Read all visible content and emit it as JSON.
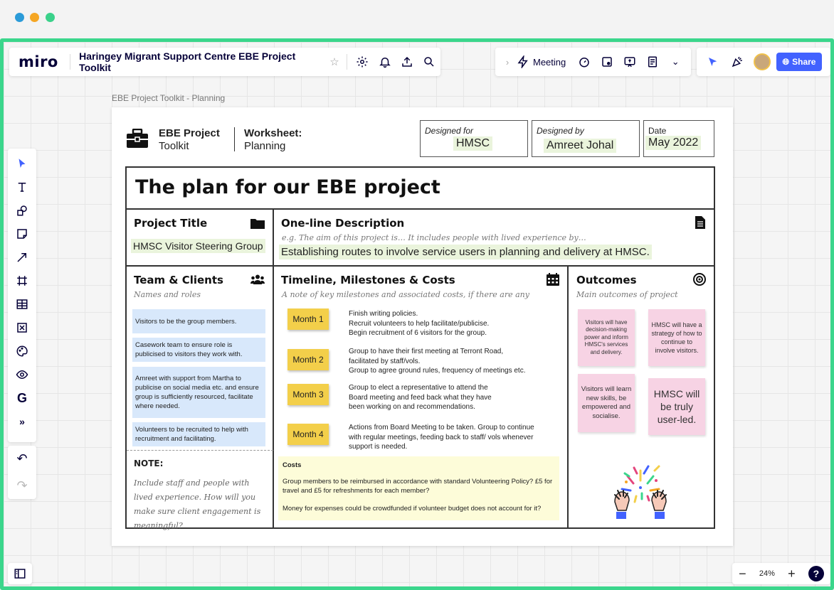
{
  "app": {
    "logo": "miro",
    "board_title": "Haringey Migrant Support Centre EBE Project Toolkit",
    "meeting_label": "Meeting",
    "share_label": "Share",
    "zoom_level": "24%",
    "zoom_out": "−",
    "zoom_in": "+",
    "help": "?"
  },
  "frame_label": "EBE Project Toolkit - Planning",
  "sheet": {
    "brand_line1": "EBE Project",
    "brand_line2": "Toolkit",
    "ws_line1": "Worksheet:",
    "ws_line2": "Planning",
    "designed_for_label": "Designed for",
    "designed_for_value": "HMSC",
    "designed_by_label": "Designed by",
    "designed_by_value": "Amreet Johal",
    "date_label": "Date",
    "date_value": "May 2022",
    "main_title": "The plan for our EBE project",
    "project_title_label": "Project Title",
    "project_title_value": "HMSC Visitor Steering Group",
    "description_label": "One-line Description",
    "description_hint": "e.g. The aim of this project is… It includes people with lived experience by…",
    "description_value": "Establishing routes to involve service users in planning and delivery at HMSC.",
    "team_label": "Team & Clients",
    "team_sub": "Names and roles",
    "team_notes": [
      "Visitors to be the group members.",
      "Casework team to ensure role is publicised to visitors they work with.",
      "Amreet with support from Martha to publicise on social media etc. and ensure group is sufficiently resourced, facilitate where needed.",
      "Volunteers to be recruited to help with recruitment and facilitating."
    ],
    "note_label": "NOTE:",
    "note_text": "Include staff and people with lived experience. How will you make sure client engagement is meaningful?",
    "timeline_label": "Timeline, Milestones & Costs",
    "timeline_sub": "A note of key milestones and associated costs, if there are any",
    "months": [
      {
        "label": "Month 1",
        "text": "Finish writing policies.\nRecruit volunteers to help facilitate/publicise.\nBegin recruitment of 6 visitors for the group."
      },
      {
        "label": "Month 2",
        "text": "Group to have their first meeting at Terront Road,\nfacilitated by staff/vols.\nGroup to agree ground rules, frequency of meetings etc."
      },
      {
        "label": "Month 3",
        "text": "Group to elect a representative to attend the\nBoard meeting and feed back what they have\nbeen working on and recommendations."
      },
      {
        "label": "Month 4",
        "text": "Actions from Board Meeting to be taken. Group to continue\nwith regular meetings, feeding back to staff/ vols whenever\nsupport is needed."
      }
    ],
    "costs_label": "Costs",
    "costs_line1": "Group members to be reimbursed in accordance with standard Volunteering Policy?  £5 for travel and £5 for refreshments for each member?",
    "costs_line2": "Money for expenses could be crowdfunded if volunteer budget does not account for it?",
    "outcomes_label": "Outcomes",
    "outcomes_sub": "Main outcomes of project",
    "outcome_notes": [
      "Visitors will have decision-making power and inform HMSC's services and delivery.",
      "HMSC will have a strategy of how to continue to involve visitors.",
      "Visitors will learn new skills, be empowered and socialise.",
      "HMSC will be truly user-led."
    ]
  },
  "colors": {
    "accent_green": "#3bd68c",
    "share_blue": "#4262ff",
    "sticky_yellow": "#f3cf4a",
    "sticky_pink": "#f7d3e4",
    "note_blue": "#d8e8fb",
    "highlight_green": "#eaf4dc"
  },
  "icons": [
    "close-dot",
    "minimize-dot",
    "zoom-dot",
    "star-icon",
    "settings-icon",
    "bell-icon",
    "upload-icon",
    "search-icon",
    "chevron-right-icon",
    "lightning-icon",
    "timer-icon",
    "card-icon",
    "present-icon",
    "notes-icon",
    "more-chevrons-icon",
    "reactions-icon",
    "celebrate-icon",
    "globe-icon",
    "cursor-icon",
    "text-icon",
    "shapes-icon",
    "sticky-note-icon",
    "arrow-icon",
    "frame-icon",
    "table-icon",
    "close-box-icon",
    "palette-icon",
    "eye-icon",
    "g-icon",
    "more-tools-icon",
    "undo-icon",
    "redo-icon",
    "sidebar-icon",
    "briefcase-icon",
    "folder-icon",
    "document-icon",
    "people-icon",
    "calendar-icon",
    "target-icon"
  ]
}
